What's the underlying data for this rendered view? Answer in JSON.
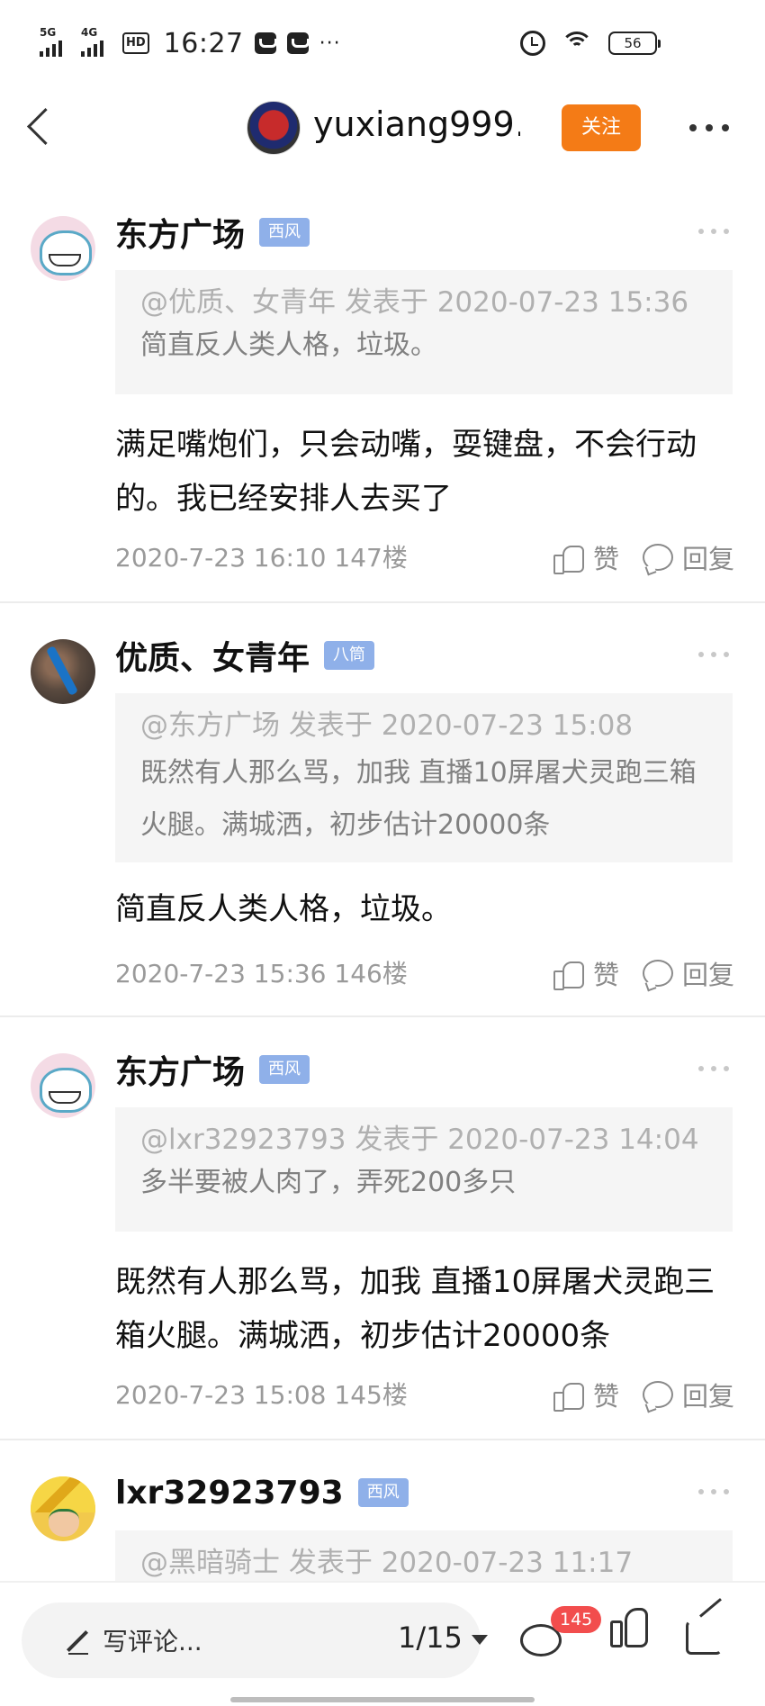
{
  "status_bar": {
    "sim1": "5G",
    "sim2": "4G",
    "hd": "HD",
    "time": "16:27",
    "more": "···",
    "battery": "56"
  },
  "header": {
    "title": "yuxiang999…",
    "follow_label": "关注"
  },
  "comments": [
    {
      "user": "东方广场",
      "badge": "西风",
      "quote_head": "@优质、女青年 发表于 2020-07-23 15:36",
      "quote_text": "简直反人类人格，垃圾。",
      "body": "满足嘴炮们，只会动嘴，耍键盘，不会行动的。我已经安排人去买了",
      "date": "2020-7-23 16:10",
      "floor": "147楼",
      "like_label": "赞",
      "reply_label": "回复"
    },
    {
      "user": "优质、女青年",
      "badge": "八筒",
      "quote_head": "@东方广场 发表于 2020-07-23 15:08",
      "quote_text": "既然有人那么骂，加我 直播10屏屠犬灵跑三箱火腿。满城洒，初步估计20000条",
      "body": "简直反人类人格，垃圾。",
      "date": "2020-7-23 15:36",
      "floor": "146楼",
      "like_label": "赞",
      "reply_label": "回复"
    },
    {
      "user": "东方广场",
      "badge": "西风",
      "quote_head": "@lxr32923793 发表于 2020-07-23 14:04",
      "quote_text": "多半要被人肉了，弄死200多只",
      "body": "既然有人那么骂，加我 直播10屏屠犬灵跑三箱火腿。满城洒，初步估计20000条",
      "date": "2020-7-23 15:08",
      "floor": "145楼",
      "like_label": "赞",
      "reply_label": "回复"
    },
    {
      "user": "lxr32923793",
      "badge": "西风",
      "quote_head": "@黑暗骑士 发表于 2020-07-23 11:17"
    }
  ],
  "bottom_bar": {
    "comment_placeholder": "写评论...",
    "page": "1/15",
    "comment_count": "145"
  }
}
